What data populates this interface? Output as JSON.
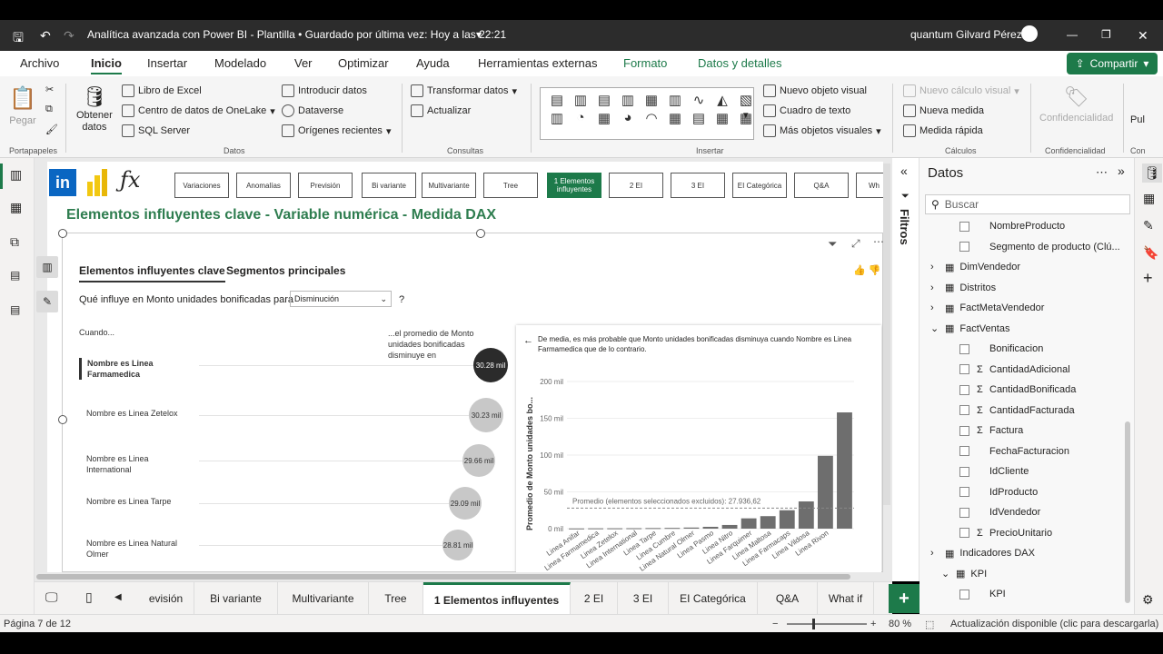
{
  "window": {
    "title": "Analítica avanzada con Power BI - Plantilla • Guardado por última vez: Hoy a las 22:21",
    "user": "quantum Gilvard Pérez"
  },
  "menu": [
    "Archivo",
    "Inicio",
    "Insertar",
    "Modelado",
    "Ver",
    "Optimizar",
    "Ayuda",
    "Herramientas externas",
    "Formato",
    "Datos y detalles"
  ],
  "share_label": "Compartir",
  "ribbon": {
    "pegar": "Pegar",
    "portapapeles": "Portapapeles",
    "obtener": "Obtener",
    "datos": "datos",
    "libro_excel": "Libro de Excel",
    "onelake": "Centro de datos de OneLake",
    "sql": "SQL Server",
    "introducir": "Introducir datos",
    "dataverse": "Dataverse",
    "origenes": "Orígenes recientes",
    "datos_group": "Datos",
    "transformar": "Transformar datos",
    "actualizar": "Actualizar",
    "consultas": "Consultas",
    "nuevo_visual": "Nuevo objeto visual",
    "cuadro_texto": "Cuadro de texto",
    "mas_visuales": "Más objetos visuales",
    "insertar_group": "Insertar",
    "nuevo_calculo": "Nuevo cálculo visual",
    "nueva_medida": "Nueva medida",
    "medida_rapida": "Medida rápida",
    "calculos": "Cálculos",
    "confidencialidad": "Confidencialidad",
    "confidencialidad_group": "Confidencialidad",
    "pub": "Pul",
    "con": "Con"
  },
  "report": {
    "nav_buttons": [
      "Variaciones",
      "Anomalías",
      "Previsión",
      "Bi variante",
      "Multivariante",
      "Tree",
      "1 Elementos influyentes",
      "2 EI",
      "3 EI",
      "EI Categórica",
      "Q&A",
      "Wh"
    ],
    "page_title": "Elementos influyentes clave - Variable numérica - Medida DAX",
    "tab_key": "Elementos influyentes clave",
    "tab_segments": "Segmentos principales",
    "question": "Qué influye en Monto unidades bonificadas para",
    "dropdown": "Disminución",
    "qmark": "?",
    "col_when": "Cuando...",
    "col_avg": "...el promedio de Monto unidades bonificadas disminuye en",
    "drivers": [
      {
        "label": "Nombre es Linea Farmamedica",
        "value": "30.28 mil"
      },
      {
        "label": "Nombre es Linea Zetelox",
        "value": "30.23 mil"
      },
      {
        "label": "Nombre es Linea International",
        "value": "29.66 mil"
      },
      {
        "label": "Nombre es Linea Tarpe",
        "value": "29.09 mil"
      },
      {
        "label": "Nombre es Linea Natural Olmer",
        "value": "28.81 mil"
      }
    ],
    "chart_note": "De media, es más probable que Monto unidades bonificadas disminuya cuando Nombre es Linea Farmamedica que de lo contrario.",
    "avg_label": "Promedio (elementos seleccionados excluidos): 27.936,62"
  },
  "chart_data": {
    "type": "bar",
    "ylabel": "Promedio de Monto unidades bo...",
    "yticks": [
      "0 mil",
      "50 mil",
      "100 mil",
      "150 mil",
      "200 mil"
    ],
    "ylim": [
      0,
      200000
    ],
    "categories": [
      "Linea Anifar",
      "Linea Farmamedica",
      "Linea Zetelox",
      "Linea International",
      "Linea Tarpe",
      "Linea Cumbre",
      "Linea Natural Olmer",
      "Linea Pasmo",
      "Linea Nitro",
      "Linea Farquimer",
      "Linea Maltosa",
      "Linea Farmacaps",
      "Linea Vildosa",
      "Linea Rivon"
    ],
    "values": [
      300,
      450,
      500,
      600,
      800,
      1000,
      1500,
      2500,
      5000,
      14000,
      17000,
      25000,
      37000,
      99000,
      158000
    ],
    "reference_line": 27936.62
  },
  "filters_label": "Filtros",
  "data_pane": {
    "title": "Datos",
    "search": "Buscar",
    "items": [
      {
        "label": "NombreProducto",
        "kind": "field",
        "indent": 2
      },
      {
        "label": "Segmento de producto (Clú...",
        "kind": "field",
        "indent": 2
      },
      {
        "label": "DimVendedor",
        "kind": "table",
        "indent": 0
      },
      {
        "label": "Distritos",
        "kind": "table",
        "indent": 0
      },
      {
        "label": "FactMetaVendedor",
        "kind": "table",
        "indent": 0
      },
      {
        "label": "FactVentas",
        "kind": "table-open",
        "indent": 0
      },
      {
        "label": "Bonificacion",
        "kind": "field",
        "indent": 2
      },
      {
        "label": "CantidadAdicional",
        "kind": "sum",
        "indent": 2
      },
      {
        "label": "CantidadBonificada",
        "kind": "sum",
        "indent": 2
      },
      {
        "label": "CantidadFacturada",
        "kind": "sum",
        "indent": 2
      },
      {
        "label": "Factura",
        "kind": "sum",
        "indent": 2
      },
      {
        "label": "FechaFacturacion",
        "kind": "field",
        "indent": 2
      },
      {
        "label": "IdCliente",
        "kind": "field",
        "indent": 2
      },
      {
        "label": "IdProducto",
        "kind": "field",
        "indent": 2
      },
      {
        "label": "IdVendedor",
        "kind": "field",
        "indent": 2
      },
      {
        "label": "PrecioUnitario",
        "kind": "sum",
        "indent": 2
      },
      {
        "label": "Indicadores DAX",
        "kind": "table",
        "indent": 0
      },
      {
        "label": "KPI",
        "kind": "table-open",
        "indent": 1
      },
      {
        "label": "KPI",
        "kind": "field",
        "indent": 2
      }
    ]
  },
  "tabs": [
    "evisión",
    "Bi variante",
    "Multivariante",
    "Tree",
    "1 Elementos influyentes",
    "2 EI",
    "3 EI",
    "EI Categórica",
    "Q&A",
    "What if"
  ],
  "status": {
    "page": "Página 7 de 12",
    "zoom": "80 %",
    "update": "Actualización disponible (clic para descargarla)"
  },
  "colors": {
    "accent": "#1d7a4a",
    "title_green": "#2e7d4f",
    "bar": "#6e6e6e"
  }
}
